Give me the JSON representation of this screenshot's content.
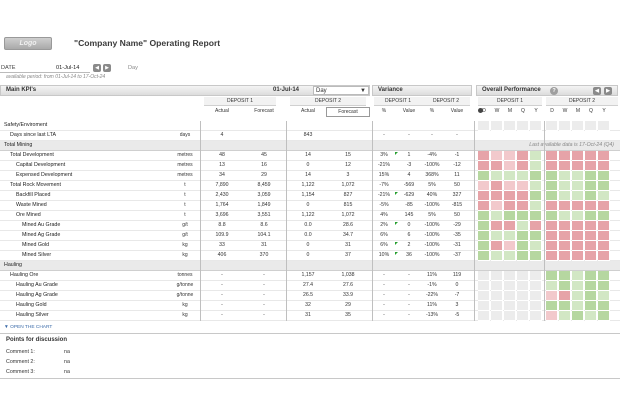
{
  "header": {
    "logo_text": "Logo",
    "title": "\"Company Name\" Operating Report"
  },
  "date_bar": {
    "label": "DATE",
    "value": "01-Jul-14",
    "unit": "Day",
    "period_note": "available period: from 01-Jul-14 to 17-Oct-24"
  },
  "main_kpis": {
    "title": "Main KPI's",
    "date": "01-Jul-14",
    "period": "Day",
    "deposit1": "DEPOSIT 1",
    "deposit2": "DEPOSIT 2",
    "col_actual": "Actual",
    "col_forecast": "Forecast"
  },
  "variance": {
    "title": "Variance",
    "deposit1": "DEPOSIT 1",
    "deposit2": "DEPOSIT 2",
    "col_pct": "%",
    "col_value": "Value"
  },
  "overall": {
    "title": "Overall Performance",
    "deposit1": "DEPOSIT 1",
    "deposit2": "DEPOSIT 2",
    "periods": [
      "D",
      "W",
      "M",
      "Q",
      "Y"
    ],
    "note": "Last available data is 17-Oct-24 (Q4)"
  },
  "colors": {
    "green_dark": "#b6d7a0",
    "green": "#d2e7c4",
    "red_dark": "#e6a3a8",
    "red": "#f2c9cc",
    "grey": "#ececec",
    "flag": "#27a030"
  },
  "rows": [
    {
      "name": "Safety/Enviroment",
      "unit": "",
      "a1": "",
      "f1": "",
      "a2": "",
      "f2": "",
      "p1": "",
      "v1": "",
      "p2": "",
      "v2": "",
      "section": false
    },
    {
      "name": "Days since last LTA",
      "unit": "days",
      "a1": "4",
      "f1": "",
      "a2": "843",
      "f2": "",
      "p1": "-",
      "v1": "-",
      "p2": "-",
      "v2": "-",
      "indent": 10
    },
    {
      "name": "Total Mining",
      "section": true
    },
    {
      "name": "Total Development",
      "unit": "metres",
      "a1": "48",
      "f1": "45",
      "a2": "14",
      "f2": "15",
      "p1": "3%",
      "v1": "1",
      "p2": "-4%",
      "v2": "-1",
      "indent": 10,
      "flag": true
    },
    {
      "name": "Capital Development",
      "unit": "metres",
      "a1": "13",
      "f1": "16",
      "a2": "0",
      "f2": "12",
      "p1": "-21%",
      "v1": "-3",
      "p2": "-100%",
      "v2": "-12",
      "indent": 16
    },
    {
      "name": "Expensed Development",
      "unit": "metres",
      "a1": "34",
      "f1": "29",
      "a2": "14",
      "f2": "3",
      "p1": "15%",
      "v1": "4",
      "p2": "368%",
      "v2": "11",
      "indent": 16
    },
    {
      "name": "Total Rock Movement",
      "unit": "t",
      "a1": "7,890",
      "f1": "8,459",
      "a2": "1,122",
      "f2": "1,072",
      "p1": "-7%",
      "v1": "-569",
      "p2": "5%",
      "v2": "50",
      "indent": 10
    },
    {
      "name": "Backfill Placed",
      "unit": "t",
      "a1": "2,430",
      "f1": "3,059",
      "a2": "1,154",
      "f2": "827",
      "p1": "-21%",
      "v1": "-629",
      "p2": "40%",
      "v2": "327",
      "indent": 16,
      "flag": true
    },
    {
      "name": "Waste Mined",
      "unit": "t",
      "a1": "1,764",
      "f1": "1,849",
      "a2": "0",
      "f2": "815",
      "p1": "-5%",
      "v1": "-85",
      "p2": "-100%",
      "v2": "-815",
      "indent": 16
    },
    {
      "name": "Ore Mined",
      "unit": "t",
      "a1": "3,696",
      "f1": "3,551",
      "a2": "1,122",
      "f2": "1,072",
      "p1": "4%",
      "v1": "145",
      "p2": "5%",
      "v2": "50",
      "indent": 16
    },
    {
      "name": "Mined Au Grade",
      "unit": "g/t",
      "a1": "8.8",
      "f1": "8.6",
      "a2": "0.0",
      "f2": "28.6",
      "p1": "2%",
      "v1": "0",
      "p2": "-100%",
      "v2": "-29",
      "indent": 22,
      "flag": true
    },
    {
      "name": "Mined Ag Grade",
      "unit": "g/t",
      "a1": "109.9",
      "f1": "104.1",
      "a2": "0.0",
      "f2": "34.7",
      "p1": "6%",
      "v1": "6",
      "p2": "-100%",
      "v2": "-35",
      "indent": 22
    },
    {
      "name": "Mined Gold",
      "unit": "kg",
      "a1": "33",
      "f1": "31",
      "a2": "0",
      "f2": "31",
      "p1": "6%",
      "v1": "2",
      "p2": "-100%",
      "v2": "-31",
      "indent": 22,
      "flag": true
    },
    {
      "name": "Mined Silver",
      "unit": "kg",
      "a1": "406",
      "f1": "370",
      "a2": "0",
      "f2": "37",
      "p1": "10%",
      "v1": "36",
      "p2": "-100%",
      "v2": "-37",
      "indent": 22,
      "flag": true
    },
    {
      "name": "Hauling",
      "section": true
    },
    {
      "name": "Hauling Ore",
      "unit": "tonnes",
      "a1": "-",
      "f1": "-",
      "a2": "1,157",
      "f2": "1,038",
      "p1": "-",
      "v1": "-",
      "p2": "11%",
      "v2": "119",
      "indent": 10
    },
    {
      "name": "Hauling Au Grade",
      "unit": "g/tonne",
      "a1": "-",
      "f1": "-",
      "a2": "27.4",
      "f2": "27.6",
      "p1": "-",
      "v1": "-",
      "p2": "-1%",
      "v2": "0",
      "indent": 16
    },
    {
      "name": "Hauling Ag Grade",
      "unit": "g/tonne",
      "a1": "-",
      "f1": "-",
      "a2": "26.5",
      "f2": "33.9",
      "p1": "-",
      "v1": "-",
      "p2": "-22%",
      "v2": "-7",
      "indent": 16
    },
    {
      "name": "Hauling Gold",
      "unit": "kg",
      "a1": "-",
      "f1": "-",
      "a2": "32",
      "f2": "29",
      "p1": "-",
      "v1": "-",
      "p2": "11%",
      "v2": "3",
      "indent": 16
    },
    {
      "name": "Hauling Silver",
      "unit": "kg",
      "a1": "-",
      "f1": "-",
      "a2": "31",
      "f2": "35",
      "p1": "-",
      "v1": "-",
      "p2": "-13%",
      "v2": "-5",
      "indent": 16
    }
  ],
  "heatmap": [
    [
      "e",
      "e",
      "e",
      "e",
      "e",
      "e",
      "e",
      "e",
      "e",
      "e"
    ],
    [
      "",
      "",
      "",
      "",
      "",
      "",
      "",
      "",
      "",
      ""
    ],
    [
      "",
      "",
      "",
      "",
      "",
      "",
      "",
      "",
      "",
      ""
    ],
    [
      "R",
      "r",
      "r",
      "R",
      "g",
      "R",
      "R",
      "R",
      "R",
      "R"
    ],
    [
      "R",
      "R",
      "r",
      "R",
      "g",
      "R",
      "R",
      "R",
      "R",
      "R"
    ],
    [
      "G",
      "g",
      "g",
      "g",
      "G",
      "G",
      "g",
      "g",
      "G",
      "G"
    ],
    [
      "r",
      "R",
      "r",
      "r",
      "g",
      "G",
      "g",
      "g",
      "G",
      "G"
    ],
    [
      "R",
      "R",
      "R",
      "R",
      "G",
      "G",
      "g",
      "g",
      "G",
      "g"
    ],
    [
      "R",
      "r",
      "R",
      "R",
      "g",
      "R",
      "R",
      "R",
      "R",
      "R"
    ],
    [
      "G",
      "g",
      "G",
      "G",
      "G",
      "G",
      "g",
      "g",
      "G",
      "G"
    ],
    [
      "G",
      "R",
      "R",
      "g",
      "R",
      "R",
      "R",
      "R",
      "R",
      "R"
    ],
    [
      "G",
      "g",
      "g",
      "G",
      "G",
      "R",
      "R",
      "R",
      "R",
      "R"
    ],
    [
      "G",
      "R",
      "r",
      "G",
      "g",
      "R",
      "R",
      "R",
      "R",
      "R"
    ],
    [
      "G",
      "g",
      "g",
      "G",
      "G",
      "R",
      "R",
      "R",
      "R",
      "R"
    ],
    [
      "",
      "",
      "",
      "",
      "",
      "",
      "",
      "",
      "",
      ""
    ],
    [
      "e",
      "e",
      "e",
      "e",
      "e",
      "G",
      "G",
      "g",
      "G",
      "G"
    ],
    [
      "e",
      "e",
      "e",
      "e",
      "e",
      "g",
      "G",
      "g",
      "G",
      "G"
    ],
    [
      "e",
      "e",
      "e",
      "e",
      "e",
      "r",
      "R",
      "g",
      "G",
      "g"
    ],
    [
      "e",
      "e",
      "e",
      "e",
      "e",
      "G",
      "G",
      "g",
      "G",
      "G"
    ],
    [
      "e",
      "e",
      "e",
      "e",
      "e",
      "r",
      "g",
      "G",
      "g",
      "G"
    ]
  ],
  "chart_link": "OPEN THE CHART",
  "discussion": {
    "title": "Points for discussion",
    "comments": [
      {
        "label": "Comment 1:",
        "value": "na"
      },
      {
        "label": "Comment 2:",
        "value": "na"
      },
      {
        "label": "Comment 3:",
        "value": "na"
      }
    ]
  }
}
